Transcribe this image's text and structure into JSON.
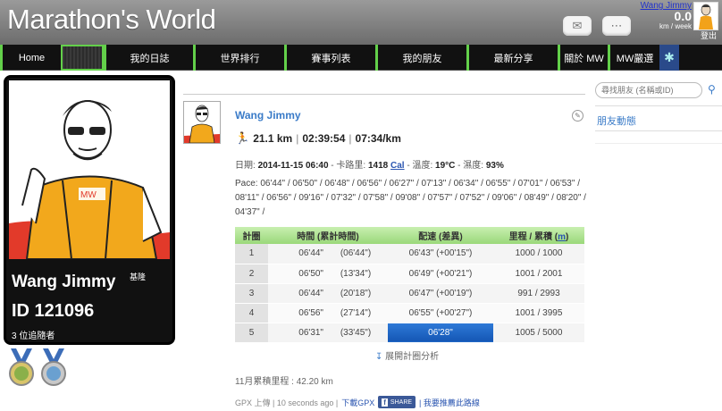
{
  "header": {
    "logo": "Marathon's World",
    "user_name": "Wang Jimmy",
    "weekly_distance": "0.0",
    "distance_unit": "km / week",
    "logout": "登出"
  },
  "nav": {
    "items": [
      "Home",
      "",
      "我的日誌",
      "世界排行",
      "賽事列表",
      "我的朋友",
      "最新分享",
      "關於 MW",
      "MW嚴選"
    ]
  },
  "profile": {
    "name": "Wang Jimmy",
    "location": "基隆",
    "id": "ID 121096",
    "followers": "3 位追隨者"
  },
  "post": {
    "author": "Wang Jimmy",
    "distance": "21.1 km",
    "duration": "02:39:54",
    "pace": "07:34/km",
    "meta_date_label": "日期: ",
    "meta_date": "2014-11-15 06:40",
    "meta_cal_label": " - 卡路里: ",
    "meta_cal": "1418",
    "meta_cal_unit": "Cal",
    "meta_temp_label": " - 溫度: ",
    "meta_temp": "19°C",
    "meta_hum_label": " - 濕度: ",
    "meta_hum": "93%",
    "pace_text": "Pace: 06'44\" / 06'50\" / 06'48\" / 06'56\" / 06'27\" / 07'13\" / 06'34\" / 06'55\" / 07'01\" / 06'53\" / 08'11\" / 06'56\" / 09'16\" / 07'32\" / 07'58\" / 09'08\" / 07'57\" / 07'52\" / 09'06\" / 08'49\" / 08'20\" / 04'37\" /"
  },
  "splits": {
    "headers": {
      "lap": "計圈",
      "time": "時間 (累計時間)",
      "pace": "配速 (差異)",
      "dist": "里程 / 累積",
      "dist_unit": "m"
    },
    "rows": [
      {
        "lap": "1",
        "time": "06'44\"",
        "cum": "(06'44\")",
        "pace": "06'43\" (+00'15\")",
        "dist": "1000 / 1000"
      },
      {
        "lap": "2",
        "time": "06'50\"",
        "cum": "(13'34\")",
        "pace": "06'49\" (+00'21\")",
        "dist": "1001 / 2001"
      },
      {
        "lap": "3",
        "time": "06'44\"",
        "cum": "(20'18\")",
        "pace": "06'47\" (+00'19\")",
        "dist": "991 / 2993"
      },
      {
        "lap": "4",
        "time": "06'56\"",
        "cum": "(27'14\")",
        "pace": "06'55\" (+00'27\")",
        "dist": "1001 / 3995"
      },
      {
        "lap": "5",
        "time": "06'31\"",
        "cum": "(33'45\")",
        "pace": "06'28\"",
        "dist": "1005 / 5000"
      }
    ]
  },
  "expand_label": "展開計圈分析",
  "monthly": "11月累積里程 : 42.20 km",
  "footer": {
    "upload": "GPX 上傳 | 10 seconds ago |",
    "download": "下載GPX",
    "share": "SHARE",
    "recommend": "| 我要推薦此路線"
  },
  "sidebar": {
    "search_placeholder": "尋找朋友 (名稱或ID)",
    "friends_activity": "朋友動態"
  },
  "colors": {
    "nav_accent": "#63d04a",
    "link": "#3a7bc8",
    "best_pace": "#1f6cc8"
  }
}
